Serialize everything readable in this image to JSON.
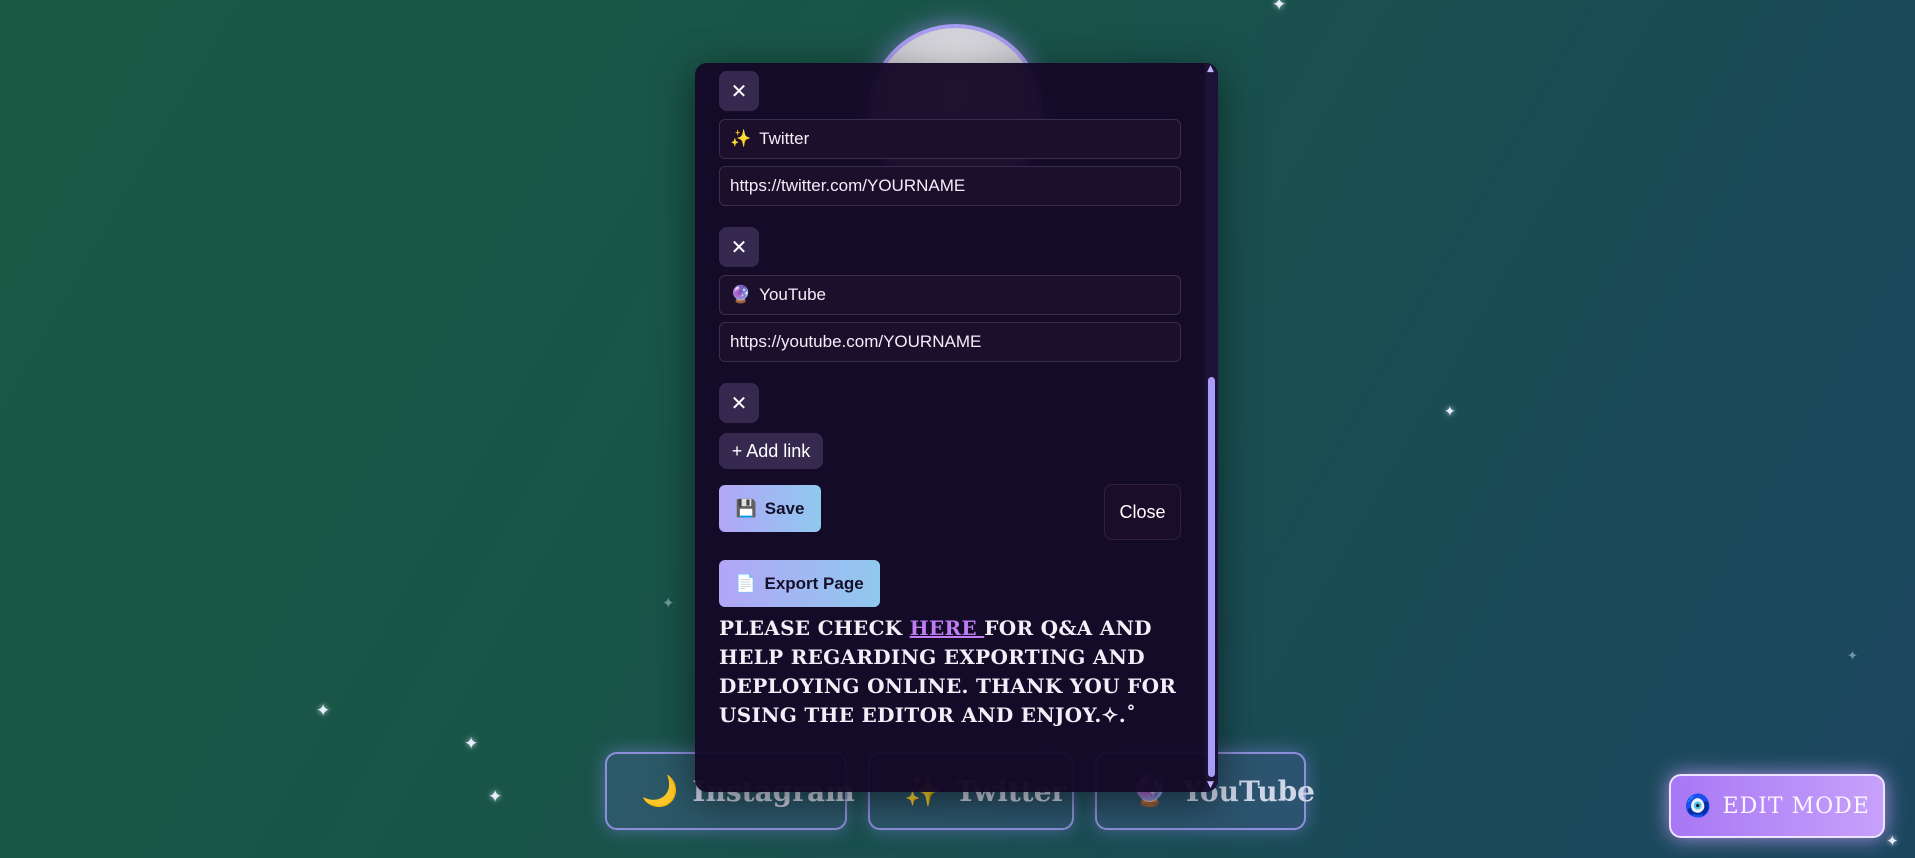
{
  "background": {
    "links": [
      {
        "emoji": "🌙",
        "label": "Instagram"
      },
      {
        "emoji": "✨",
        "label": "Twitter"
      },
      {
        "emoji": "🔮",
        "label": "YouTube"
      }
    ]
  },
  "edit_mode": {
    "icon": "🧿",
    "label": "EDIT MODE"
  },
  "panel": {
    "links": [
      {
        "emoji": "✨",
        "name": "Twitter",
        "url": "https://twitter.com/YOURNAME"
      },
      {
        "emoji": "🔮",
        "name": "YouTube",
        "url": "https://youtube.com/YOURNAME"
      }
    ],
    "remove_glyph": "✕",
    "add_link_label": "+ Add link",
    "save": {
      "icon": "💾",
      "label": "Save"
    },
    "close_label": "Close",
    "export": {
      "icon": "📄",
      "label": "Export Page"
    },
    "help": {
      "before": "PLEASE CHECK ",
      "link": "HERE ",
      "after": "FOR Q&A AND HELP REGARDING EXPORTING AND DEPLOYING ONLINE. THANK YOU FOR USING THE EDITOR AND ENJOY.✧.˚"
    },
    "scroll_up": "▲",
    "scroll_down": "▼"
  },
  "colors": {
    "panel_bg": "#140826",
    "button_gradient_start": "#b2a6f7",
    "button_gradient_end": "#8fc9ee",
    "link_accent": "#c07cf2",
    "edit_mode_start": "#a877f5",
    "edit_mode_end": "#c6a1fb"
  }
}
